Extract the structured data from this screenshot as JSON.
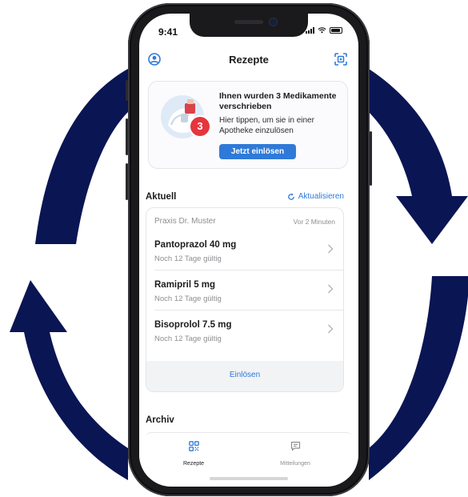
{
  "colors": {
    "arrow_navy": "#0a1553",
    "accent_blue": "#2f7ad8",
    "badge_red": "#e5353d",
    "phone_frame": "#1a1a1c"
  },
  "status_bar": {
    "time": "9:41"
  },
  "nav": {
    "title": "Rezepte",
    "left_icon": "profile-icon",
    "right_icon": "scan-icon"
  },
  "promo": {
    "badge_count": "3",
    "title": "Ihnen wurden 3 Medikamente verschrieben",
    "description": "Hier tippen, um sie in einer Apotheke einzulösen",
    "cta_label": "Jetzt einlösen"
  },
  "current": {
    "heading": "Aktuell",
    "refresh_label": "Aktualisieren",
    "practice": "Praxis Dr. Muster",
    "time_ago": "Vor 2 Minuten",
    "medications": [
      {
        "name": "Pantoprazol 40 mg",
        "validity": "Noch 12 Tage gültig"
      },
      {
        "name": "Ramipril 5 mg",
        "validity": "Noch 12 Tage gültig"
      },
      {
        "name": "Bisoprolol 7.5 mg",
        "validity": "Noch 12 Tage gültig"
      }
    ],
    "redeem_label": "Einlösen"
  },
  "archive": {
    "heading": "Archiv"
  },
  "tabbar": {
    "tabs": [
      {
        "label": "Rezepte",
        "icon": "prescriptions-icon",
        "active": true
      },
      {
        "label": "Mitteilungen",
        "icon": "messages-icon",
        "active": false
      }
    ]
  }
}
